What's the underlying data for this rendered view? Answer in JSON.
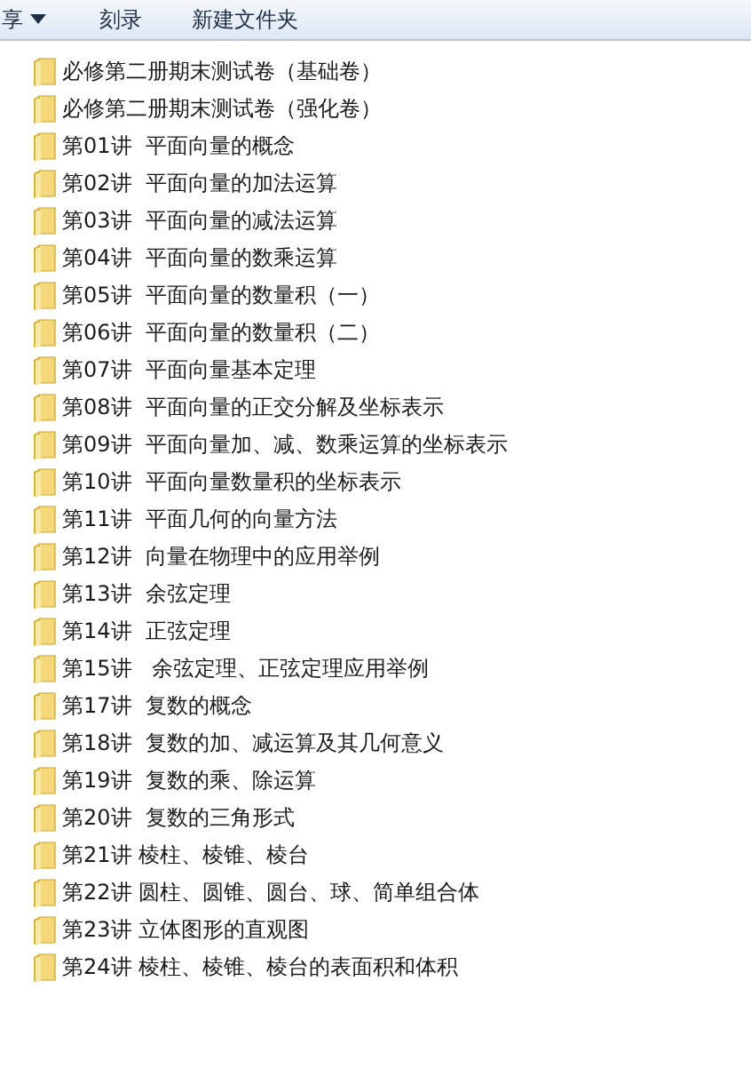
{
  "toolbar": {
    "items": [
      {
        "label": "享",
        "kind": "dropdown"
      },
      {
        "label": "刻录",
        "kind": "button"
      },
      {
        "label": "新建文件夹",
        "kind": "button"
      }
    ]
  },
  "files": [
    {
      "name": "必修第二册期末测试卷（基础卷）"
    },
    {
      "name": "必修第二册期末测试卷（强化卷）"
    },
    {
      "name": "第01讲  平面向量的概念"
    },
    {
      "name": "第02讲  平面向量的加法运算"
    },
    {
      "name": "第03讲  平面向量的减法运算"
    },
    {
      "name": "第04讲  平面向量的数乘运算"
    },
    {
      "name": "第05讲  平面向量的数量积（一）"
    },
    {
      "name": "第06讲  平面向量的数量积（二）"
    },
    {
      "name": "第07讲  平面向量基本定理"
    },
    {
      "name": "第08讲  平面向量的正交分解及坐标表示"
    },
    {
      "name": "第09讲  平面向量加、减、数乘运算的坐标表示"
    },
    {
      "name": "第10讲  平面向量数量积的坐标表示"
    },
    {
      "name": "第11讲  平面几何的向量方法"
    },
    {
      "name": "第12讲  向量在物理中的应用举例"
    },
    {
      "name": "第13讲  余弦定理"
    },
    {
      "name": "第14讲  正弦定理"
    },
    {
      "name": "第15讲   余弦定理、正弦定理应用举例"
    },
    {
      "name": "第17讲  复数的概念"
    },
    {
      "name": "第18讲  复数的加、减运算及其几何意义"
    },
    {
      "name": "第19讲  复数的乘、除运算"
    },
    {
      "name": "第20讲  复数的三角形式"
    },
    {
      "name": "第21讲 棱柱、棱锥、棱台"
    },
    {
      "name": "第22讲 圆柱、圆锥、圆台、球、简单组合体"
    },
    {
      "name": "第23讲 立体图形的直观图"
    },
    {
      "name": "第24讲 棱柱、棱锥、棱台的表面积和体积"
    }
  ]
}
